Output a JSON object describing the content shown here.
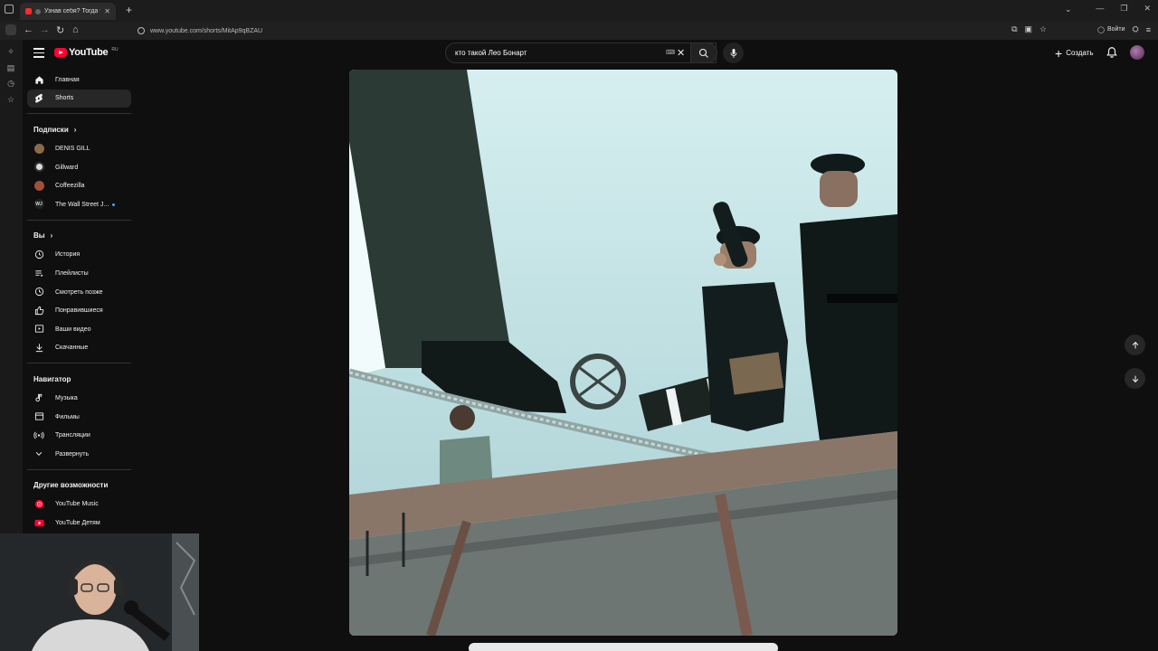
{
  "browser": {
    "tab_title": "Узнав себя? Тогда ты не о...",
    "url": "www.youtube.com/shorts/MitAp9qBZAU",
    "login_label": "Войти"
  },
  "masthead": {
    "logo_text": "YouTube",
    "logo_region": "RU",
    "search_value": "кто такой Лео Бонарт",
    "create_label": "Создать"
  },
  "sidebar": {
    "top": [
      {
        "label": "Главная",
        "icon": "home-icon"
      },
      {
        "label": "Shorts",
        "icon": "shorts-icon"
      }
    ],
    "subs_header": "Подписки",
    "subs": [
      {
        "label": "DENIS GILL",
        "color": "#8a6a4a"
      },
      {
        "label": "Gillward",
        "color": "#dcdcdc"
      },
      {
        "label": "Coffeezilla",
        "color": "#a0503a"
      },
      {
        "label": "The Wall Street J...",
        "color": "#222222"
      }
    ],
    "you_header": "Вы",
    "you": [
      {
        "label": "История",
        "icon": "history-icon"
      },
      {
        "label": "Плейлисты",
        "icon": "playlists-icon"
      },
      {
        "label": "Смотреть позже",
        "icon": "watch-later-icon"
      },
      {
        "label": "Понравившиеся",
        "icon": "like-icon"
      },
      {
        "label": "Ваши видео",
        "icon": "your-videos-icon"
      },
      {
        "label": "Скачанные",
        "icon": "download-icon"
      }
    ],
    "nav_header": "Навигатор",
    "nav": [
      {
        "label": "Музыка",
        "icon": "music-icon"
      },
      {
        "label": "Фильмы",
        "icon": "movies-icon"
      },
      {
        "label": "Трансляции",
        "icon": "live-icon"
      },
      {
        "label": "Развернуть",
        "icon": "chevron-down-icon"
      }
    ],
    "more_header": "Другие возможности",
    "more": [
      {
        "label": "YouTube Music",
        "icon": "youtube-music-icon"
      },
      {
        "label": "YouTube Детям",
        "icon": "youtube-kids-icon"
      }
    ]
  },
  "colors": {
    "brand_red": "#ff0033",
    "background": "#0f0f0f"
  }
}
